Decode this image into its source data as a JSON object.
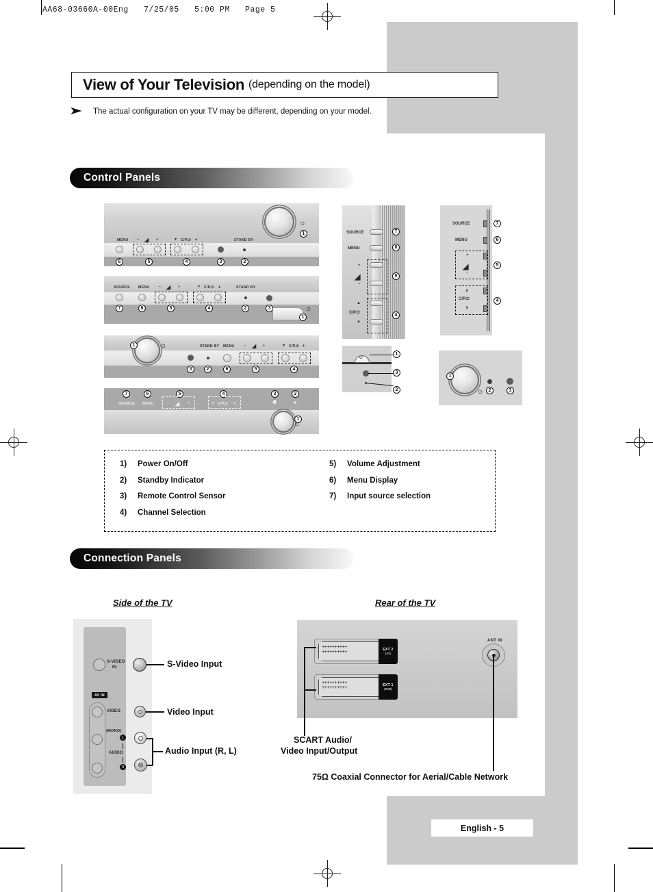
{
  "print_header": "AA68-03660A-00Eng   7/25/05   5:00 PM   Page 5",
  "title": {
    "main": "View of Your Television",
    "sub": "(depending on the model)"
  },
  "note": {
    "arrow": "➤",
    "text": "The actual configuration on your TV may be different, depending on your model."
  },
  "sections": {
    "control_panels": "Control Panels",
    "connection_panels": "Connection Panels"
  },
  "panel_labels": {
    "menu": "MENU",
    "source": "SOURCE",
    "standby": "STAND BY",
    "vol_minus": "–",
    "vol_plus": "+",
    "vol_icon": "◢",
    "ch_down_tri": "▼",
    "ch_up_tri": "▲",
    "ch_down_v": "∨",
    "ch_up_v": "∧",
    "channel": "C/P.⏻",
    "power_icon": "⏻"
  },
  "callouts": [
    "1",
    "2",
    "3",
    "4",
    "5",
    "6",
    "7"
  ],
  "legend": {
    "left": [
      {
        "num": "1)",
        "text": "Power On/Off"
      },
      {
        "num": "2)",
        "text": "Standby Indicator"
      },
      {
        "num": "3)",
        "text": "Remote Control Sensor"
      },
      {
        "num": "4)",
        "text": "Channel Selection"
      }
    ],
    "right": [
      {
        "num": "5)",
        "text": "Volume Adjustment"
      },
      {
        "num": "6)",
        "text": "Menu Display"
      },
      {
        "num": "7)",
        "text": "Input source selection"
      }
    ]
  },
  "connection": {
    "side_title": "Side of the TV",
    "rear_title": "Rear of the TV",
    "side_panel": {
      "svideo": "S-VIDEO\nIN",
      "svideo_l1": "S-VIDEO",
      "svideo_l2": "IN",
      "avin": "AV IN",
      "video": "VIDEO",
      "mono": "(MONO)",
      "audio": "AUDIO",
      "left_ch": "L",
      "right_ch": "R"
    },
    "side_callouts": [
      {
        "text": "S-Video Input"
      },
      {
        "text": "Video Input"
      },
      {
        "text": "Audio Input (R, L)"
      }
    ],
    "rear_panel": {
      "ext2_name": "EXT 2",
      "ext2_type": "(AV)",
      "ext1_name": "EXT 1",
      "ext1_type": "(RGB)",
      "ant_in": "ANT IN"
    },
    "rear_callouts": {
      "scart_line1": "SCART Audio/",
      "scart_line2": "Video Input/Output",
      "coax": "75Ω Coaxial Connector for Aerial/Cable Network"
    }
  },
  "footer": {
    "page_label": "English - 5"
  },
  "colors": {
    "grey_block": "#cbcbcb",
    "ink": "#111111",
    "panel": "#c4c4c4"
  }
}
